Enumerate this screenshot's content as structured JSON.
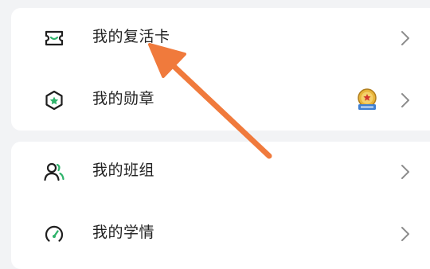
{
  "menu_groups": [
    {
      "items": [
        {
          "label": "我的复活卡",
          "icon": "ticket-icon"
        },
        {
          "label": "我的勋章",
          "icon": "hexagon-medal-icon",
          "badge": "medal-badge-icon"
        }
      ]
    },
    {
      "items": [
        {
          "label": "我的班组",
          "icon": "group-users-icon"
        },
        {
          "label": "我的学情",
          "icon": "gauge-icon"
        }
      ]
    }
  ],
  "colors": {
    "background": "#f2f3f5",
    "card": "#ffffff",
    "text": "#222222",
    "icon": "#1f1f1f",
    "accent_green": "#2fb36b",
    "chevron": "#8c8c8c",
    "annotation_arrow": "#f07a3c"
  }
}
